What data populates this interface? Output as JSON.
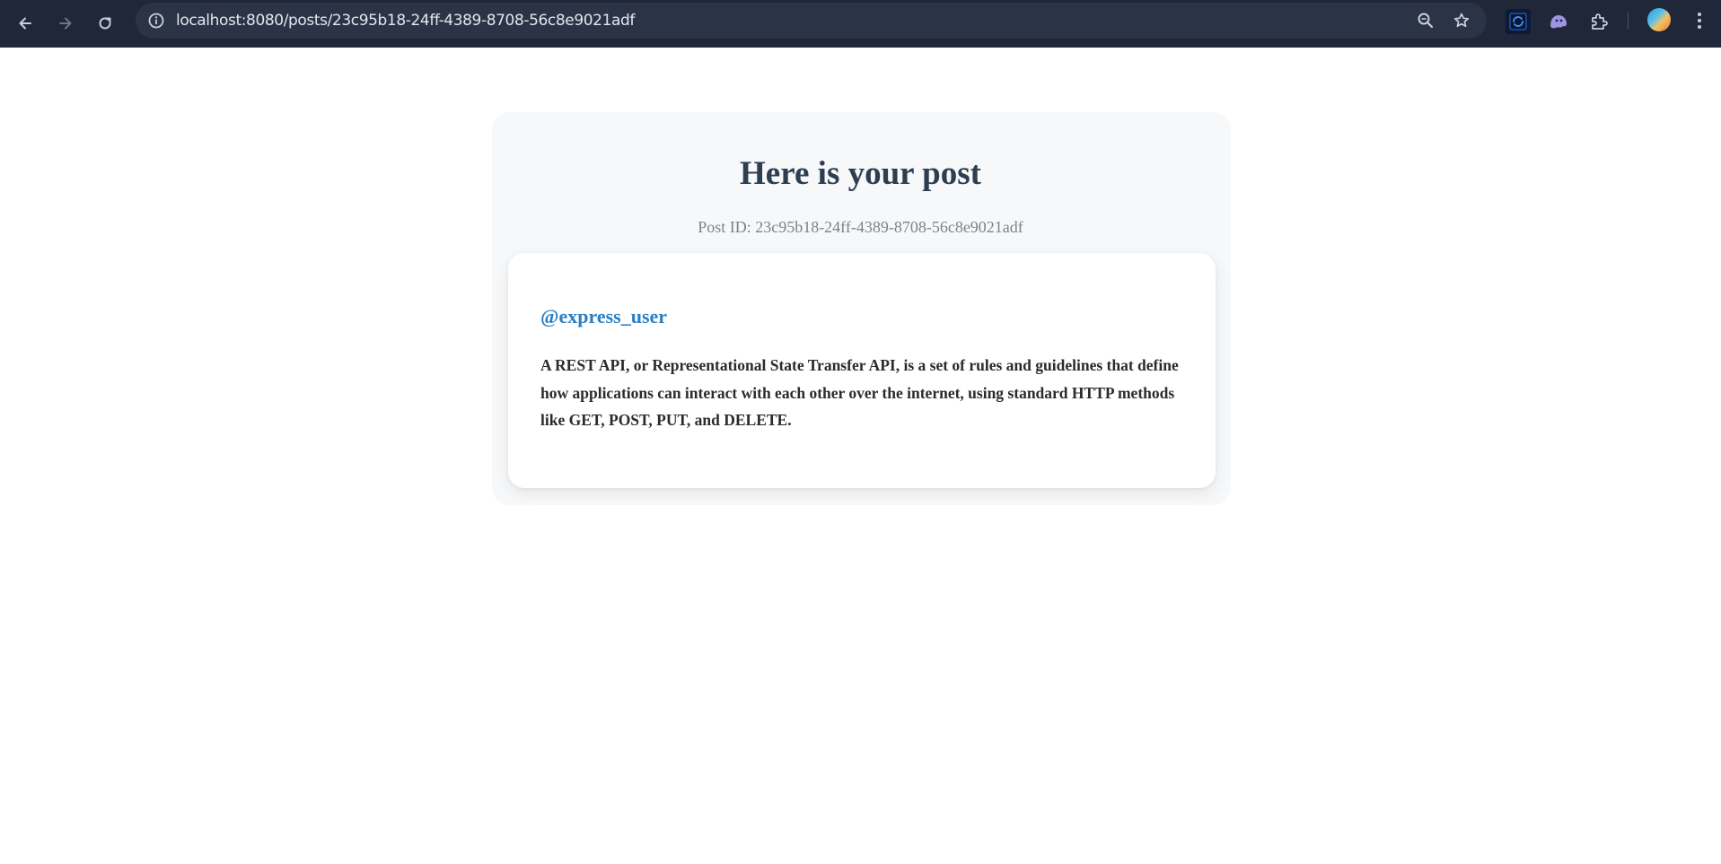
{
  "browser": {
    "url": "localhost:8080/posts/23c95b18-24ff-4389-8708-56c8e9021adf",
    "icons": {
      "back": "arrow-left-icon",
      "forward": "arrow-right-icon",
      "reload": "reload-icon",
      "site_info": "info-icon",
      "zoom": "zoom-icon",
      "bookmark": "star-icon",
      "extension_1": "sync-extension-icon",
      "extension_2": "ghost-extension-icon",
      "extensions": "puzzle-icon",
      "profile": "avatar-icon",
      "menu": "kebab-menu-icon"
    }
  },
  "page": {
    "title": "Here is your post",
    "post_id_line": "Post ID: 23c95b18-24ff-4389-8708-56c8e9021adf"
  },
  "post": {
    "username": "@express_user",
    "content": "A REST API, or Representational State Transfer API, is a set of rules and guidelines that define how applications can interact with each other over the internet, using standard HTTP methods like GET, POST, PUT, and DELETE."
  },
  "colors": {
    "toolbar_bg": "#202738",
    "omnibox_bg": "#2b3346",
    "title": "#2c3e50",
    "username": "#2d7fc1",
    "body_text": "#2b2b2b",
    "outer_card_bg": "#f7f8fa"
  }
}
